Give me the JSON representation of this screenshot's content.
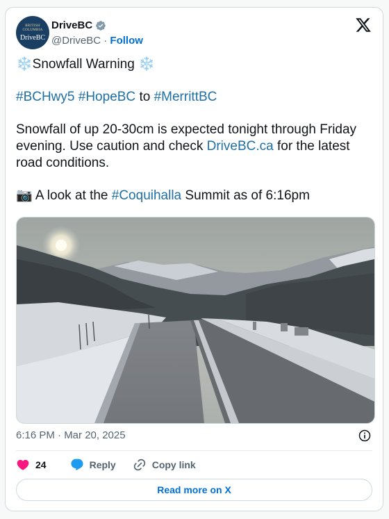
{
  "author": {
    "name": "DriveBC",
    "handle": "@DriveBC",
    "separator": "·",
    "follow_label": "Follow",
    "avatar_crest_text": "BRITISH COLUMBIA",
    "avatar_logo_text": "DriveBC"
  },
  "tweet": {
    "title_emoji_left": "❄️",
    "title": "Snowfall Warning",
    "title_emoji_right": "❄️",
    "tag1": "#BCHwy5",
    "tag2": "#HopeBC",
    "to": "to",
    "tag3": "#MerrittBC",
    "body_part1": "Snowfall of up 20-30cm is expected tonight through Friday evening. Use caution and check ",
    "body_link": "DriveBC.ca",
    "body_part2": " for the latest road conditions.",
    "camera_emoji": "📷",
    "look_part1": " A look at the ",
    "look_tag": "#Coquihalla",
    "look_part2": " Summit as of 6:16pm"
  },
  "timestamp": "6:16 PM · Mar 20, 2025",
  "actions": {
    "like_count": "24",
    "reply_label": "Reply",
    "copy_label": "Copy link"
  },
  "read_more_label": "Read more on X",
  "colors": {
    "link": "#1d6fa5",
    "follow": "#006fd6",
    "heart": "#f91880",
    "reply_bubble": "#1d9bf0",
    "verified": "#829aab"
  }
}
